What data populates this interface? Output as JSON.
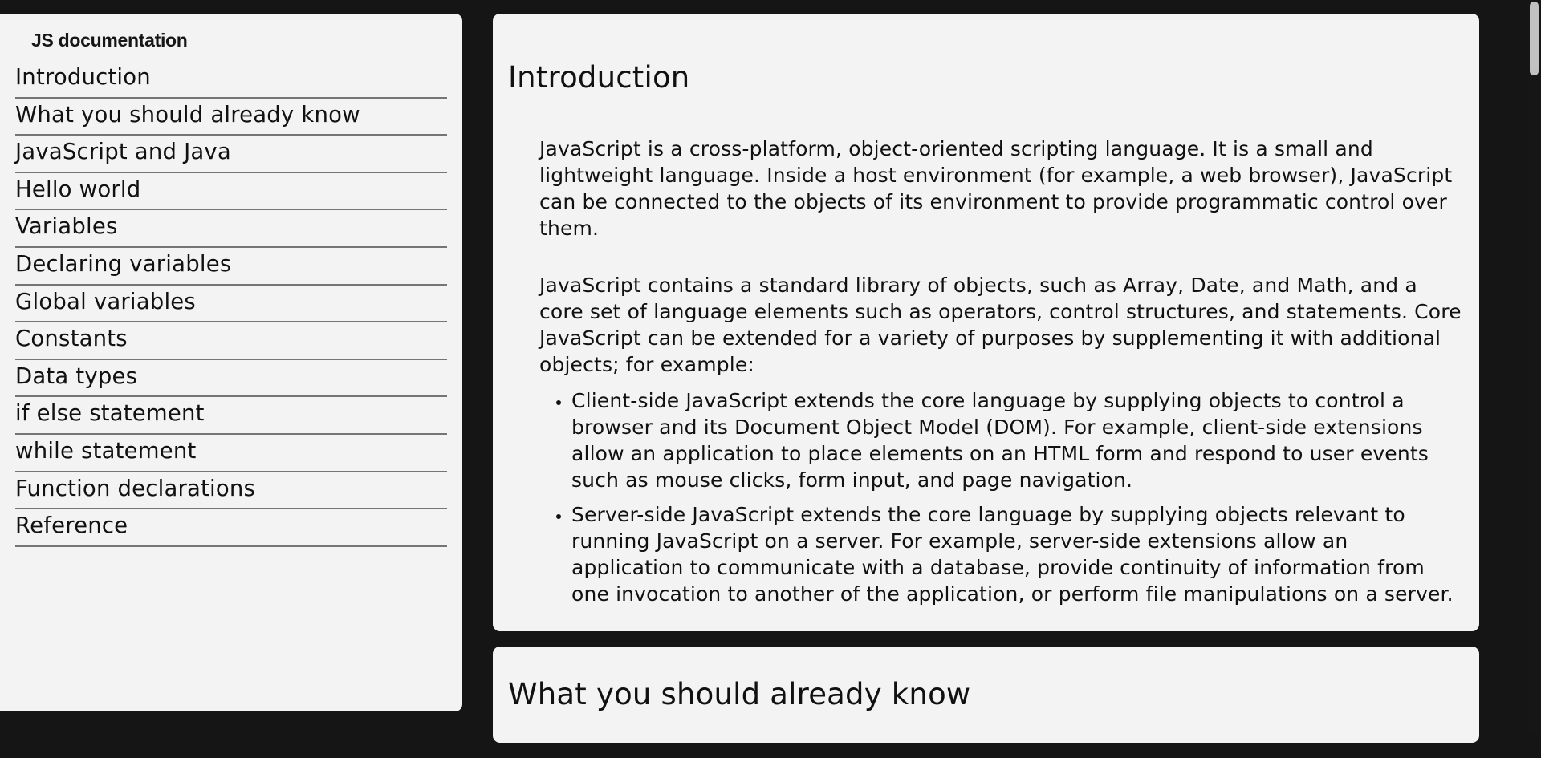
{
  "navbar": {
    "title": "JS documentation",
    "items": [
      "Introduction",
      "What you should already know",
      "JavaScript and Java",
      "Hello world",
      "Variables",
      "Declaring variables",
      "Global variables",
      "Constants",
      "Data types",
      "if else statement",
      "while statement",
      "Function declarations",
      "Reference"
    ]
  },
  "sections": {
    "introduction": {
      "title": "Introduction",
      "p1": "JavaScript is a cross-platform, object-oriented scripting language. It is a small and lightweight language. Inside a host environment (for example, a web browser), JavaScript can be connected to the objects of its environment to provide programmatic control over them.",
      "p2": "JavaScript contains a standard library of objects, such as Array, Date, and Math, and a core set of language elements such as operators, control structures, and statements. Core JavaScript can be extended for a variety of purposes by supplementing it with additional objects; for example:",
      "list": [
        "Client-side JavaScript extends the core language by supplying objects to control a browser and its Document Object Model (DOM). For example, client-side extensions allow an application to place elements on an HTML form and respond to user events such as mouse clicks, form input, and page navigation.",
        "Server-side JavaScript extends the core language by supplying objects relevant to running JavaScript on a server. For example, server-side extensions allow an application to communicate with a database, provide continuity of information from one invocation to another of the application, or perform file manipulations on a server."
      ]
    },
    "what_you_should_know": {
      "title": "What you should already know"
    }
  },
  "colors": {
    "background": "#151515",
    "panel": "#f3f3f3",
    "divider": "#757575",
    "scroll_thumb": "#c1c1c1"
  }
}
